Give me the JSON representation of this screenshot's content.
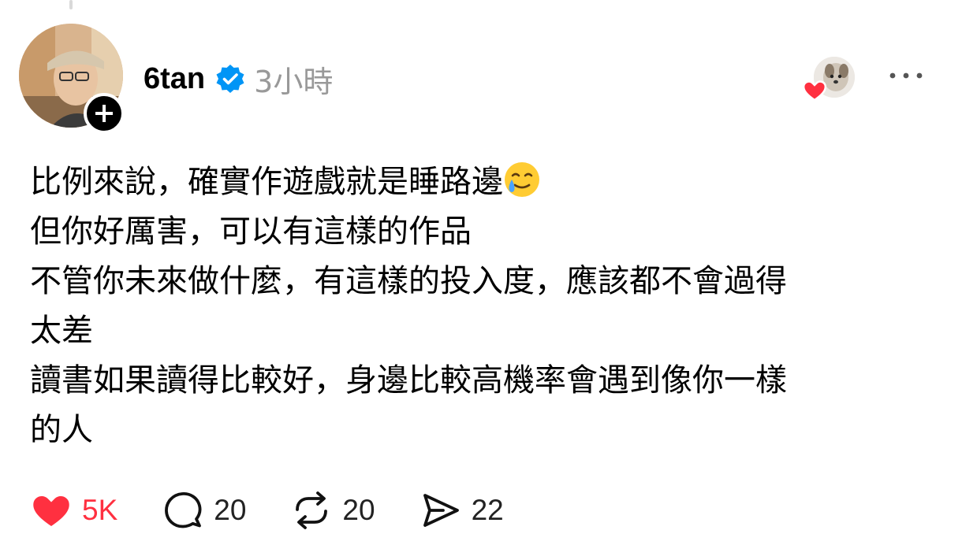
{
  "post": {
    "author": {
      "username": "6tan",
      "verified": true,
      "avatar": "user-avatar-photo",
      "follow_icon": "plus-icon"
    },
    "timestamp": "3小時",
    "liked_by_icon": "liker-avatar-dog",
    "more_icon": "more-horizontal-icon",
    "content_lines": [
      "比例來說，確實作遊戲就是睡路邊",
      "但你好厲害，可以有這樣的作品",
      "不管你未來做什麼，有這樣的投入度，應該都不會過得",
      "太差",
      "讀書如果讀得比較好，身邊比較高機率會遇到像你一樣",
      "的人"
    ],
    "emoji": "smiling-face-with-tear-emoji",
    "actions": {
      "like": {
        "icon": "heart-icon",
        "count": "5K",
        "liked": true
      },
      "comment": {
        "icon": "comment-icon",
        "count": "20"
      },
      "repost": {
        "icon": "repost-icon",
        "count": "20"
      },
      "share": {
        "icon": "share-icon",
        "count": "22"
      }
    }
  },
  "colors": {
    "like_red": "#ff3040",
    "verified_blue": "#0095f6",
    "timestamp_gray": "#999999",
    "text": "#000000"
  }
}
